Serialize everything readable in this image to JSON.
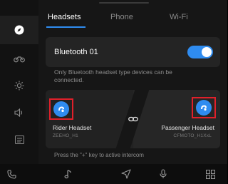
{
  "tabs": [
    {
      "label": "Headsets"
    },
    {
      "label": "Phone"
    },
    {
      "label": "Wi-Fi"
    }
  ],
  "sidebar": {
    "items": [
      {
        "icon": "compass-icon",
        "active": true
      },
      {
        "icon": "motorcycle-icon",
        "active": false
      },
      {
        "icon": "brightness-icon",
        "active": false
      },
      {
        "icon": "volume-icon",
        "active": false
      },
      {
        "icon": "list-icon",
        "active": false
      }
    ]
  },
  "bluetooth": {
    "label": "Bluetooth 01",
    "enabled": true,
    "note": "Only Bluetooth headset type devices can be connected."
  },
  "headsets": {
    "rider": {
      "name": "Rider Headset",
      "device_id": "ZEEHO_H1"
    },
    "passenger": {
      "name": "Passenger Headset",
      "device_id": "CFMOTO_H1XxL"
    }
  },
  "intercom_hint": "Press the \"+\" key to active intercom",
  "bottom_nav": [
    "phone-icon",
    "music-icon",
    "navigation-icon",
    "microphone-icon",
    "apps-grid-icon"
  ],
  "colors": {
    "accent": "#2f8cf0",
    "highlight_box": "#e0202a"
  }
}
